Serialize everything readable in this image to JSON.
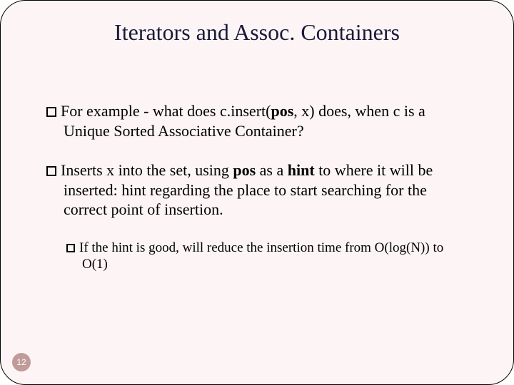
{
  "title": "Iterators and Assoc. Containers",
  "bullets": {
    "b1": {
      "prefix": "For example - what does c.insert(",
      "pos": "pos",
      "suffix": ", x) does, when c is a Unique Sorted Associative Container?"
    },
    "b2": {
      "prefix": "Inserts x into the set, using ",
      "pos": "pos",
      "mid": " as a ",
      "hint": "hint",
      "suffix": " to where it will be inserted: hint regarding the place to start searching for the correct point of insertion."
    },
    "b2sub": "If the hint is good, will reduce the insertion time from O(log(N)) to O(1)"
  },
  "page_number": "12"
}
